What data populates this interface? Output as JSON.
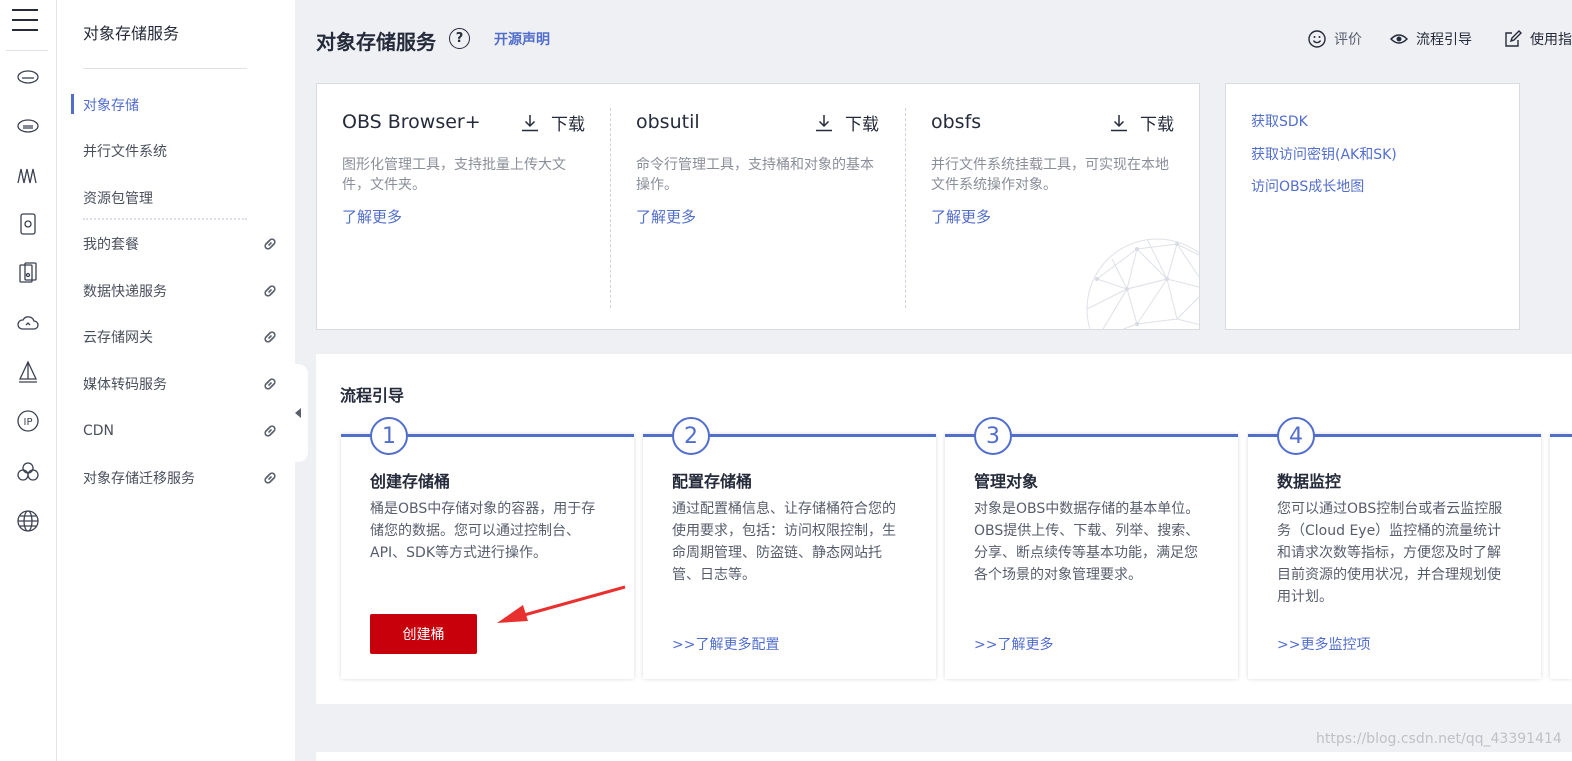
{
  "sidebar": {
    "title": "对象存储服务",
    "items": [
      {
        "label": "对象存储",
        "active": true
      },
      {
        "label": "并行文件系统"
      },
      {
        "label": "资源包管理"
      },
      {
        "label": "我的套餐",
        "external": true
      },
      {
        "label": "数据快递服务",
        "external": true
      },
      {
        "label": "云存储网关",
        "external": true
      },
      {
        "label": "媒体转码服务",
        "external": true
      },
      {
        "label": "CDN",
        "external": true
      },
      {
        "label": "对象存储迁移服务",
        "external": true
      }
    ]
  },
  "rail_icons": [
    "menu-icon",
    "storage-drive-icon",
    "storage-disk-icon",
    "waves-icon",
    "box-icon",
    "server-icon",
    "cloud-icon",
    "sail-icon",
    "ip-icon",
    "cluster-icon",
    "globe-icon"
  ],
  "header": {
    "title": "对象存储服务",
    "help": "?",
    "open_source": "开源声明",
    "actions": [
      {
        "label": "评价",
        "icon": "smile-icon"
      },
      {
        "label": "流程引导",
        "icon": "eye-icon"
      },
      {
        "label": "使用指",
        "icon": "edit-icon"
      }
    ]
  },
  "tools": [
    {
      "name": "OBS Browser+",
      "download": "下载",
      "desc": "图形化管理工具，支持批量上传大文件，文件夹。",
      "more": "了解更多"
    },
    {
      "name": "obsutil",
      "download": "下载",
      "desc": "命令行管理工具，支持桶和对象的基本操作。",
      "more": "了解更多"
    },
    {
      "name": "obsfs",
      "download": "下载",
      "desc": "并行文件系统挂载工具，可实现在本地文件系统操作对象。",
      "more": "了解更多"
    }
  ],
  "quick_links": [
    "获取SDK",
    "获取访问密钥(AK和SK)",
    "访问OBS成长地图"
  ],
  "guide": {
    "title": "流程引导",
    "steps": [
      {
        "num": "1",
        "name": "创建存储桶",
        "desc": "桶是OBS中存储对象的容器，用于存储您的数据。您可以通过控制台、API、SDK等方式进行操作。",
        "button": "创建桶"
      },
      {
        "num": "2",
        "name": "配置存储桶",
        "desc": "通过配置桶信息、让存储桶符合您的使用要求，包括：访问权限控制，生命周期管理、防盗链、静态网站托管、日志等。",
        "link": ">>了解更多配置"
      },
      {
        "num": "3",
        "name": "管理对象",
        "desc": "对象是OBS中数据存储的基本单位。OBS提供上传、下载、列举、搜索、分享、断点续传等基本功能，满足您各个场景的对象管理要求。",
        "link": ">>了解更多"
      },
      {
        "num": "4",
        "name": "数据监控",
        "desc": "您可以通过OBS控制台或者云监控服务（Cloud Eye）监控桶的流量统计和请求次数等指标，方便您及时了解目前资源的使用状况，并合理规划使用计划。",
        "link": ">>更多监控项"
      }
    ]
  },
  "watermark": "https://blog.csdn.net/qq_43391414",
  "colors": {
    "accent": "#526ecc",
    "primary_button": "#c7000b",
    "annotation_arrow": "#e8312f"
  }
}
